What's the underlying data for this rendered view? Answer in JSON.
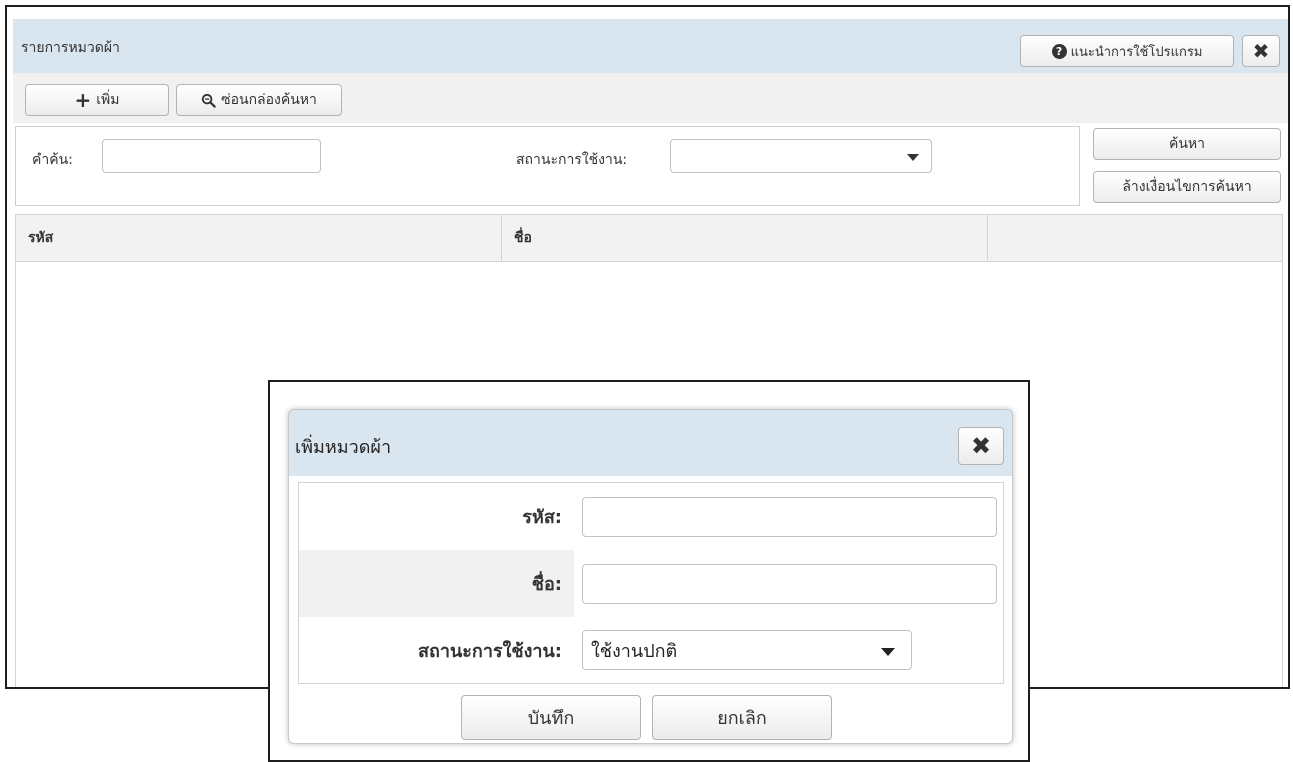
{
  "window": {
    "title": "รายการหมวดผ้า",
    "help_label": "แนะนำการใช้โปรแกรม",
    "close_glyph": "✖"
  },
  "toolbar": {
    "add_label": "เพิ่ม",
    "hide_search_label": "ซ่อนกล่องค้นหา"
  },
  "search": {
    "keyword_label": "คำค้น:",
    "keyword_value": "",
    "status_label": "สถานะการใช้งาน:",
    "status_value": "",
    "search_label": "ค้นหา",
    "clear_label": "ล้างเงื่อนไขการค้นหา"
  },
  "grid": {
    "columns": [
      "รหัส",
      "ชื่อ",
      ""
    ],
    "rows": []
  },
  "dialog": {
    "title": "เพิ่มหมวดผ้า",
    "close_glyph": "✖",
    "code_label": "รหัส:",
    "code_value": "",
    "name_label": "ชื่อ:",
    "name_value": "",
    "status_label": "สถานะการใช้งาน:",
    "status_value": "ใช้งานปกติ",
    "save_label": "บันทึก",
    "cancel_label": "ยกเลิก"
  },
  "colors": {
    "titlebar_bg": "#d9e5ef",
    "toolbar_bg": "#f1f1f1",
    "header_bg": "#f2f2f2",
    "frame_border": "#1e1e1e"
  }
}
